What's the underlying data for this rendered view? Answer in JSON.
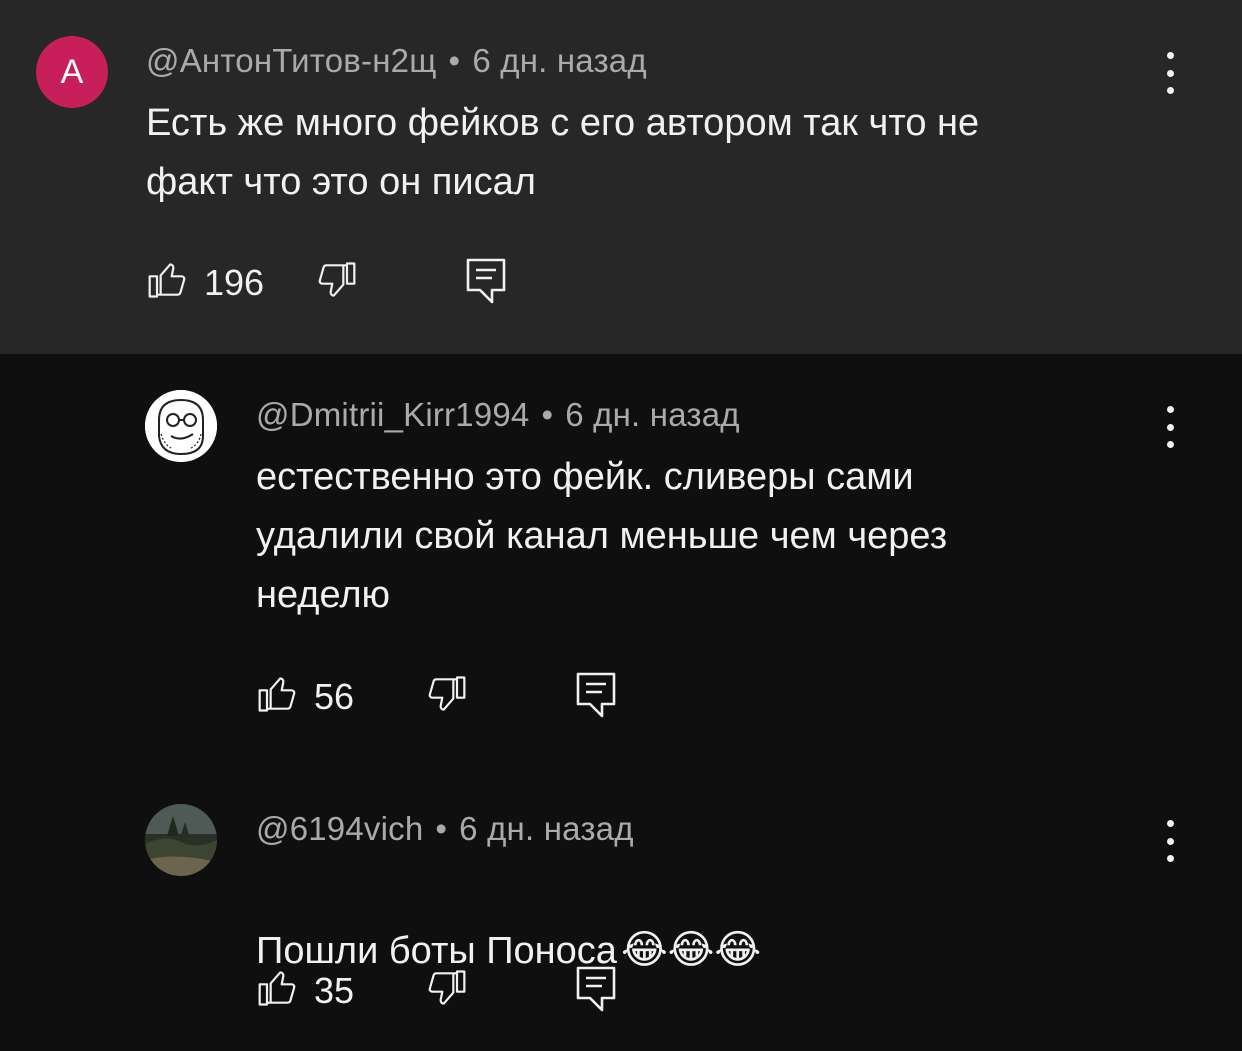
{
  "comments": [
    {
      "avatar_letter": "А",
      "author": "@АнтонТитов-н2щ",
      "time": "6 дн. назад",
      "text": "Есть же много фейков с его автором так что не\nфакт что это он писал",
      "likes": "196"
    },
    {
      "author": "@Dmitrii_Kirr1994",
      "time": "6 дн. назад",
      "text": "естественно это фейк. сливеры сами\nудалили свой канал меньше чем через\nнеделю",
      "likes": "56"
    },
    {
      "author": "@6194vich",
      "time": "6 дн. назад",
      "text": "Пошли боты Поноса",
      "emojis": "😂😂😂",
      "likes": "35"
    }
  ],
  "separator": "•",
  "icons": {
    "like": "thumbs-up-icon",
    "dislike": "thumbs-down-icon",
    "reply": "reply-icon",
    "menu": "more-vert-icon"
  },
  "colors": {
    "background": "#0f0f0f",
    "highlighted_background": "#272727",
    "avatar_letter_bg": "#c81e5a",
    "meta_text": "#aaaaaa",
    "primary_text": "#f1f1f1"
  }
}
